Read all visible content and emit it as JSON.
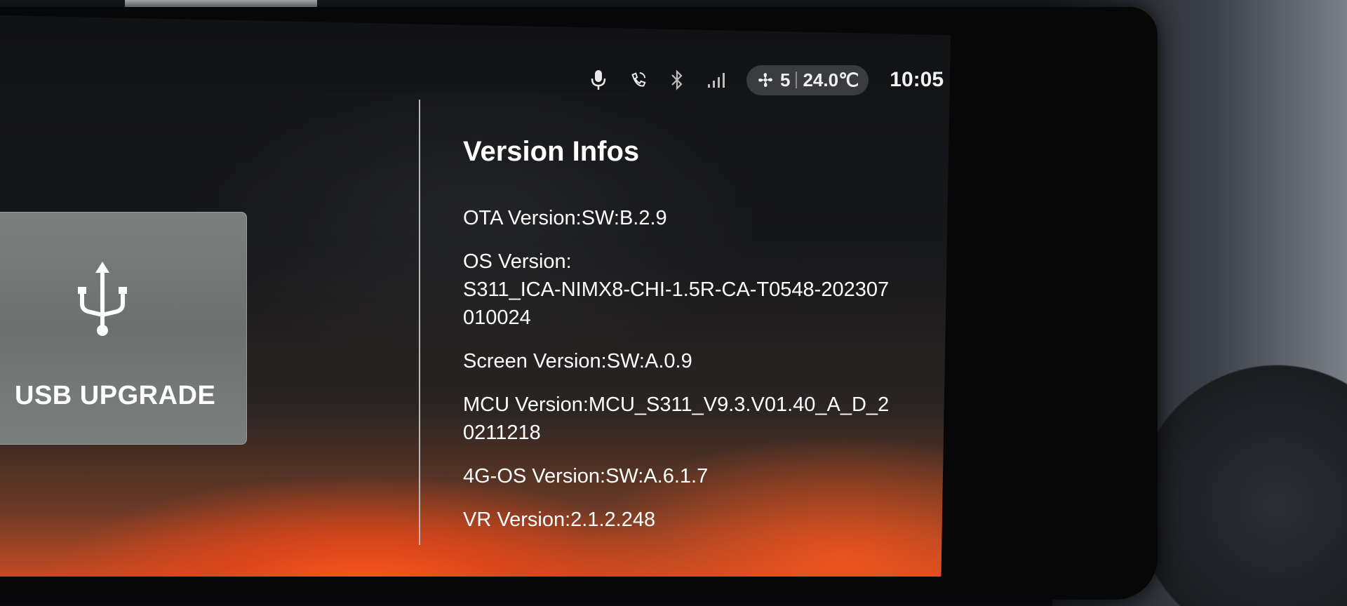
{
  "status_bar": {
    "icons": [
      "microphone-icon",
      "phone-link-icon",
      "bluetooth-icon",
      "signal-icon"
    ],
    "climate": {
      "fan_icon": "fan-icon",
      "fan_level": "5",
      "temperature": "24.0℃"
    },
    "time": "10:05"
  },
  "usb_upgrade": {
    "icon": "usb-icon",
    "label": "USB UPGRADE"
  },
  "version_infos": {
    "title": "Version Infos",
    "items": [
      {
        "label": "OTA Version:",
        "value": "SW:B.2.9"
      },
      {
        "label": "OS Version:",
        "value": "S311_ICA-NIMX8-CHI-1.5R-CA-T0548-202307010024"
      },
      {
        "label": "Screen Version:",
        "value": "SW:A.0.9"
      },
      {
        "label": "MCU Version:",
        "value": "MCU_S311_V9.3.V01.40_A_D_20211218"
      },
      {
        "label": "4G-OS Version:",
        "value": "SW:A.6.1.7"
      },
      {
        "label": "VR Version:",
        "value": "2.1.2.248"
      }
    ]
  },
  "colors": {
    "screen_glow": "#f0521e",
    "text": "#ffffff",
    "card_bg": "#747877",
    "pill_bg": "#3a3b3f"
  }
}
